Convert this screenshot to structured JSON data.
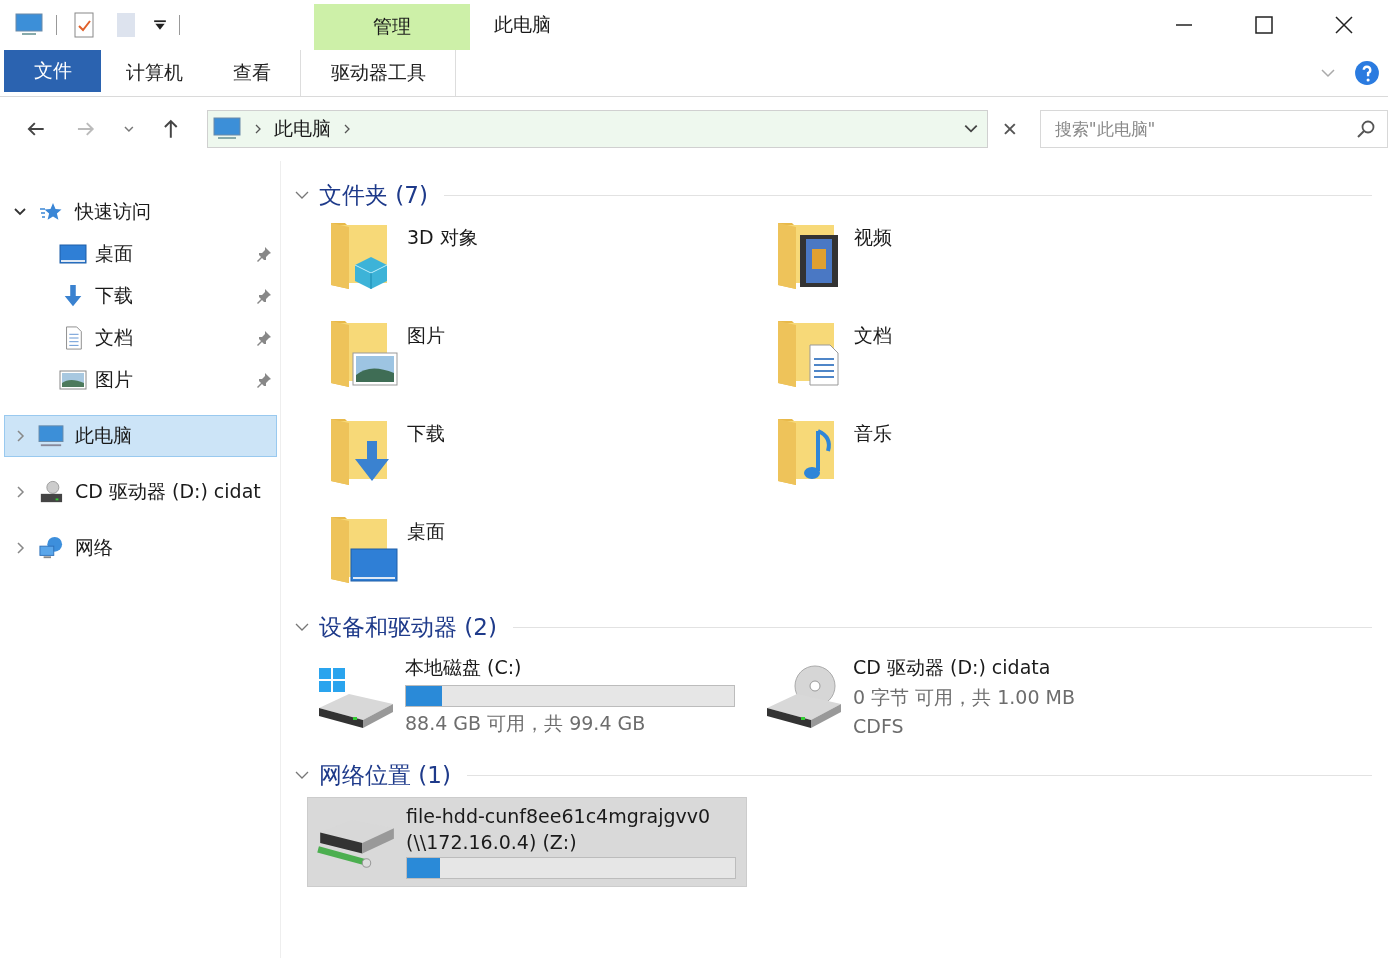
{
  "window": {
    "title": "此电脑",
    "contextual_group": "管理"
  },
  "ribbon_tabs": [
    {
      "label": "文件",
      "kind": "file",
      "selected": false
    },
    {
      "label": "计算机",
      "kind": "normal",
      "selected": false
    },
    {
      "label": "查看",
      "kind": "normal",
      "selected": false
    },
    {
      "label": "驱动器工具",
      "kind": "contextual",
      "selected": false
    }
  ],
  "address_bar": {
    "path": [
      "此电脑"
    ]
  },
  "search": {
    "placeholder": "搜索\"此电脑\""
  },
  "sidebar": {
    "items": [
      {
        "label": "快速访问",
        "kind": "quick",
        "expanded": true,
        "selected": false,
        "children": [
          {
            "label": "桌面",
            "kind": "desktop",
            "pinned": true
          },
          {
            "label": "下载",
            "kind": "download",
            "pinned": true
          },
          {
            "label": "文档",
            "kind": "document",
            "pinned": true
          },
          {
            "label": "图片",
            "kind": "picture",
            "pinned": true
          }
        ]
      },
      {
        "label": "此电脑",
        "kind": "pc",
        "expanded": false,
        "selected": true
      },
      {
        "label": "CD 驱动器 (D:) cidat",
        "kind": "cd",
        "expanded": false,
        "selected": false
      },
      {
        "label": "网络",
        "kind": "network",
        "expanded": false,
        "selected": false
      }
    ]
  },
  "sections": [
    {
      "title": "文件夹 (7)",
      "expanded": true,
      "kind": "folders",
      "items": [
        {
          "label": "3D 对象",
          "kind": "objects"
        },
        {
          "label": "视频",
          "kind": "video"
        },
        {
          "label": "图片",
          "kind": "picture"
        },
        {
          "label": "文档",
          "kind": "document"
        },
        {
          "label": "下载",
          "kind": "download"
        },
        {
          "label": "音乐",
          "kind": "music"
        },
        {
          "label": "桌面",
          "kind": "desktop"
        }
      ]
    },
    {
      "title": "设备和驱动器 (2)",
      "expanded": true,
      "kind": "drives",
      "items": [
        {
          "name": "本地磁盘 (C:)",
          "kind": "windows",
          "level": 0.11,
          "detail": "88.4 GB 可用，共 99.4 GB",
          "selected": false
        },
        {
          "name": "CD 驱动器 (D:) cidata",
          "kind": "cd",
          "detail": "0 字节 可用，共 1.00 MB",
          "filesystem": "CDFS",
          "selected": false
        }
      ]
    },
    {
      "title": "网络位置 (1)",
      "expanded": true,
      "kind": "drives",
      "items": [
        {
          "name": "file-hdd-cunf8ee61c4mgrajgvv0",
          "name2": "(\\\\172.16.0.4) (Z:)",
          "kind": "network",
          "level": 0.1,
          "selected": true
        }
      ]
    }
  ]
}
